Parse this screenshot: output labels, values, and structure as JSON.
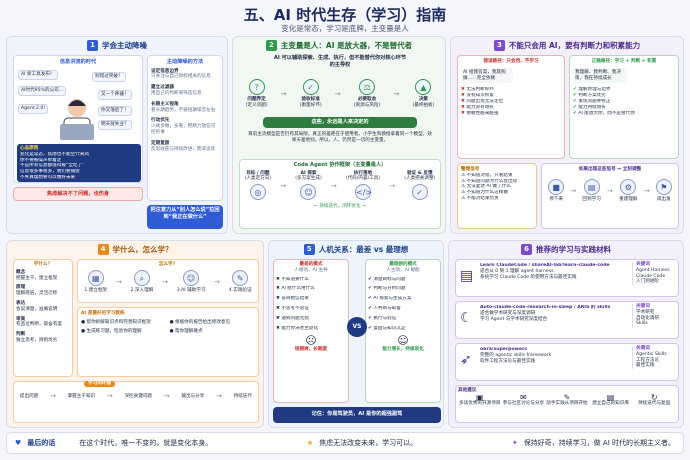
{
  "header": {
    "title": "五、AI 时代生存（学习）指南",
    "subtitle": "变化是常态，学习是底牌，主变量是人"
  },
  "p1": {
    "num": "1",
    "title": "学会主动降噪",
    "info_title": "信息洪流的时代",
    "bubbles": [
      "AI 新工具发布！",
      "别错过突破！",
      "AI时代95%的公司...",
      "又一个神器！",
      "Agent 2.0!",
      "你又落后了！",
      "明天就失业？"
    ],
    "heart_title": "心态原则",
    "heart_items": [
      "变化是常态，焦虑也不能空穴来风",
      "你不要被噪声牵着走",
      "不是所有信息都值得被“全吃了”",
      "信息很多事很多，我们要捕捉",
      "不失真理想要可以做好未来"
    ],
    "alert": "焦虑解决不了问题，也伤身",
    "method_title": "主动降噪的方法",
    "methods": [
      [
        "设定信息边界",
        "只关注与自己目标相关的信息"
      ],
      [
        "建立过滤器",
        "用自己的判断来筛选信息"
      ],
      [
        "长期主义视角",
        "看长期趋势，不被短期噪音左右"
      ],
      [
        "行动优先",
        "少刷多做，多看，把精力放在可控的事"
      ],
      [
        "定期复盘",
        "反思收获与持续改进，而非追焦"
      ]
    ],
    "focus": "把注意力从“别人怎么说”拉回到“我正在做什么”"
  },
  "p2": {
    "num": "2",
    "title": "主变量是人：AI 是放大器，不是替代者",
    "intro": "AI 可以辅助探索、生成、执行，但不能替代你对核心环节的主导权",
    "steps": [
      [
        "问题界定",
        "(定义问题)"
      ],
      [
        "验收标准",
        "(衡量好坏)"
      ],
      [
        "必要取舍",
        "(资源与风险)"
      ],
      [
        "决策",
        "(最终拍板)"
      ]
    ],
    "note": "这些，永远是人来决定的",
    "desc": "目前主流模型是否仍有其局限，真正的差距在于使用者。小学生和教授拿着同一个模型，效果天差地别。所以，人，仍然是一切的主变量。",
    "frame_title": "Code Agent 协作框架（主变量是人）",
    "frame": [
      [
        "目标 / 问题",
        "(人类定方向)"
      ],
      [
        "AI 探索",
        "(多方案生成)"
      ],
      [
        "执行落地",
        "(代码/内容/工具)"
      ],
      [
        "验证 & 反馈",
        "(人类把关调整)"
      ]
    ],
    "loop": "← 持续迭代，闭环优化 →"
  },
  "p3": {
    "num": "3",
    "title": "不能只会用 AI，要有判断力和积累能力",
    "wrong_title": "错误路径：只会用，不学习",
    "wrong_text": "AI 给我答案，我就照做……完全依赖",
    "right_title": "正确路径：学习 + 判断 + 积累",
    "right_text": "我理解、我判断、我决策，我在持续成长",
    "wrong_list": [
      "无法判断好坏",
      "没有知识积累",
      "问题出现无法定位",
      "能力没有增长",
      "依赖性越来越强"
    ],
    "right_list": [
      "理解原理与边界",
      "判断方案优劣",
      "发现问题并修正",
      "能力持续增长",
      "AI 能放大你，而不是替代你"
    ],
    "warn_title": "警惕信号",
    "warns": [
      "不知道对错，只看结果",
      "不知道问题为什么会出现",
      "无法复述 AI 做了什么",
      "不知道为什么这样做",
      "不能对结果负责"
    ],
    "cycle_title": "如果出现这些信号 → 立刻调整",
    "cycle": [
      "停下来",
      "回到学习",
      "重建理解",
      "再出发"
    ]
  },
  "p4": {
    "num": "4",
    "title": "学什么，怎么学？",
    "what_title": "学什么？",
    "what": [
      [
        "概念",
        "把握主干，建立框架"
      ],
      [
        "原理",
        "理解底层，灵活迁移"
      ],
      [
        "表达",
        "会说清楚，准确说明"
      ],
      [
        "审美",
        "有品位判断，取舍有度"
      ],
      [
        "判断",
        "独立思考，辨别优劣"
      ]
    ],
    "how_title": "怎么学？",
    "how": [
      "1.建立框架",
      "2.深入理解",
      "3.AI 辅助学习",
      "4.实践验证"
    ],
    "ai_title": "AI 是最好的学习教练",
    "ai_items": [
      "帮你拆解知识点和完善知识框架",
      "生成练习题，检验你的理解",
      "根据你的报告给出修改意见",
      "帮你理解难点"
    ],
    "loop_title": "学习闭环图",
    "loop": [
      "提出问题",
      "掌握主干知识",
      "深挖关键问题",
      "输出与分享",
      "持续迭代"
    ]
  },
  "p5": {
    "num": "5",
    "title": "人机关系：最差 vs 最理想",
    "worst_title": "最差的模式",
    "worst_sub": "人被动，AI 主导",
    "worst": [
      "不知道要什么",
      "AI 给什么用什么",
      "盲目相信结果",
      "不思考不验证",
      "遇到问题无措",
      "能力停滞甚至退化"
    ],
    "best_title": "最理想的模式",
    "best_sub": "人主动，AI 赋能",
    "best": [
      "清楚目标与问题",
      "判断与分析问题",
      "AI 探索与生成方案",
      "人判断与取舍",
      "执行与验证",
      "复盘与知识沉淀"
    ],
    "vs": "VS",
    "worst_foot": "短期爽，长期废",
    "best_foot": "能力增长，持续进化",
    "remember": "记住：你是驾驶员，AI 是你的超强副驾"
  },
  "p6": {
    "num": "6",
    "title": "推荐的学习与实践材料",
    "items": [
      {
        "name": "Learn ClaudeCode / shareAI-lab/learn-claude-code",
        "desc": [
          "适合从 0 到 1 理解 agent harness",
          "系统学习 Claude Code 的使用方法与最佳实践"
        ],
        "kw": [
          "关键词",
          "Agent Harness",
          "Claude Code",
          "入门到进阶"
        ]
      },
      {
        "name": "Auto-claude-code-research-in-sleep / ARIS 的 skills",
        "desc": [
          "适合做学术研究与深度调研",
          "学习 Agent 与学术研究深度结合"
        ],
        "kw": [
          "关键词",
          "学术研究",
          "自动化调研",
          "Skills"
        ]
      },
      {
        "name": "obra/superpowers",
        "desc": [
          "完整的 agentic skills framework",
          "软件工程方法论与最佳实践"
        ],
        "kw": [
          "关键词",
          "Agentic Skills",
          "工程方法论",
          "最佳实践"
        ]
      }
    ],
    "other_title": "其他建议",
    "others": [
      "多读优秀的开源项目",
      "参与社区讨论与分享",
      "动手实践从项目开始",
      "建立自己的知识库",
      "持续迭代与复盘"
    ]
  },
  "footer": [
    {
      "label": "最后的话",
      "text": "在这个时代，唯一不变的，就是变化本身。"
    },
    {
      "label": "",
      "text": "焦虑无法改变未来，学习可以。"
    },
    {
      "label": "",
      "text": "保持好奇，持续学习，做 AI 时代的长期主义者。"
    }
  ]
}
